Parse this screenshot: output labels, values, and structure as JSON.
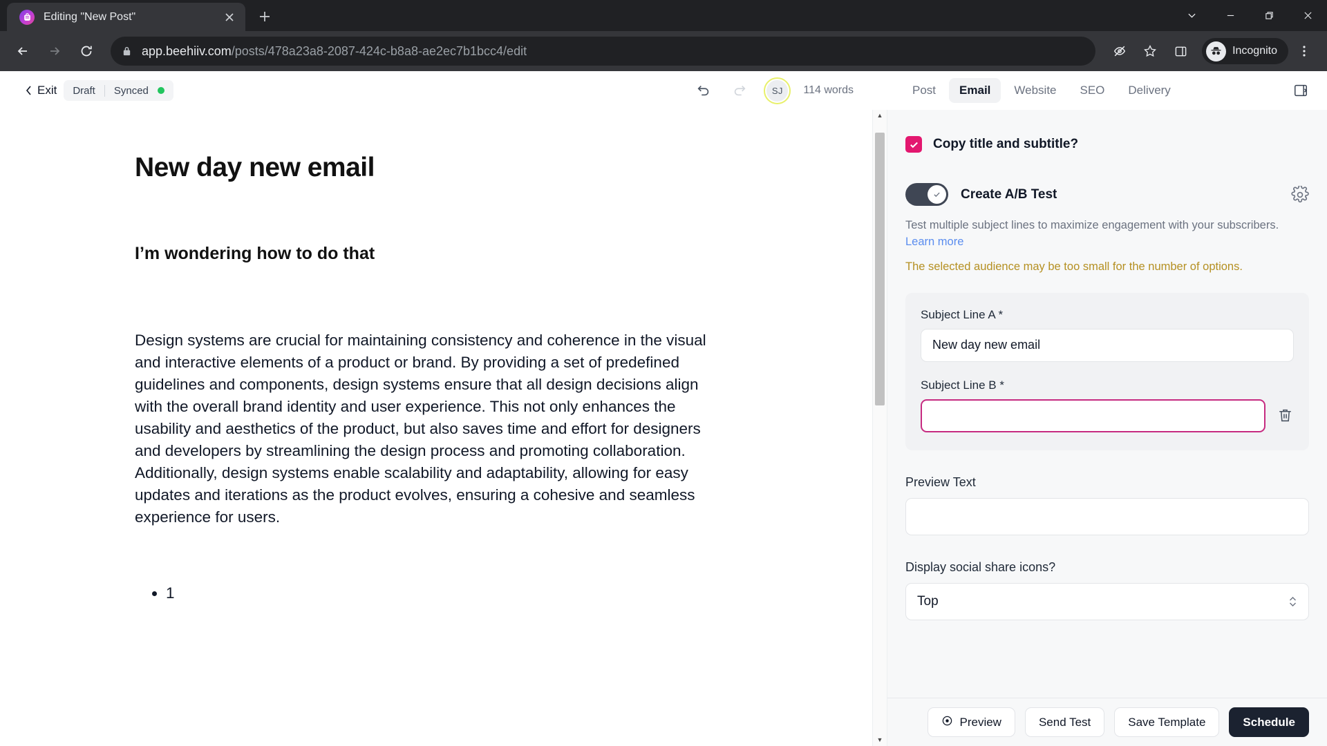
{
  "browser": {
    "tab_title": "Editing \"New Post\"",
    "favicon": "beehiiv-icon",
    "close_tab": "close-tab-icon",
    "new_tab": "new-tab-icon",
    "url_domain": "app.beehiiv.com",
    "url_path": "/posts/478a23a8-2087-424c-b8a8-ae2ec7b1bcc4/edit",
    "profile_label": "Incognito",
    "window": {
      "minimize": "minimize-icon",
      "maximize": "maximize-icon",
      "close": "close-icon",
      "tab_search": "tab-search-icon"
    }
  },
  "app_header": {
    "exit_label": "Exit",
    "status": "Draft",
    "sync_status": "Synced",
    "avatar_initials": "SJ",
    "word_count": "114 words",
    "tabs": [
      {
        "label": "Post",
        "active": false
      },
      {
        "label": "Email",
        "active": true
      },
      {
        "label": "Website",
        "active": false
      },
      {
        "label": "SEO",
        "active": false
      },
      {
        "label": "Delivery",
        "active": false
      }
    ]
  },
  "editor": {
    "title": "New day new email",
    "subtitle": "I’m wondering how to do that",
    "paragraph": "Design systems are crucial for maintaining consistency and coherence in the visual and interactive elements of a product or brand. By providing a set of predefined guidelines and components, design systems ensure that all design decisions align with the overall brand identity and user experience. This not only enhances the usability and aesthetics of the product, but also saves time and effort for designers and developers by streamlining the design process and promoting collaboration. Additionally, design systems enable scalability and adaptability, allowing for easy updates and iterations as the product evolves, ensuring a cohesive and seamless experience for users.",
    "list_items": [
      "1"
    ]
  },
  "panel": {
    "copy_title_label": "Copy title and subtitle?",
    "copy_title_checked": true,
    "ab_test_label": "Create A/B Test",
    "ab_test_enabled": true,
    "ab_helper_text": "Test multiple subject lines to maximize engagement with your subscribers.",
    "ab_helper_link": "Learn more",
    "warning": "The selected audience may be too small for the number of options.",
    "subject_a_label": "Subject Line A *",
    "subject_a_value": "New day new email",
    "subject_b_label": "Subject Line B *",
    "subject_b_value": "",
    "preview_text_label": "Preview Text",
    "preview_text_value": "",
    "social_label": "Display social share icons?",
    "social_value": "Top"
  },
  "footer": {
    "preview": "Preview",
    "send_test": "Send Test",
    "save_template": "Save Template",
    "schedule": "Schedule"
  },
  "colors": {
    "accent_pink": "#e3176f",
    "focus_pink": "#c62a80",
    "warning": "#b59022",
    "link": "#5b8def",
    "primary_dark": "#1b2230",
    "sync_green": "#22c55e",
    "avatar_ring": "#e8f06a"
  }
}
